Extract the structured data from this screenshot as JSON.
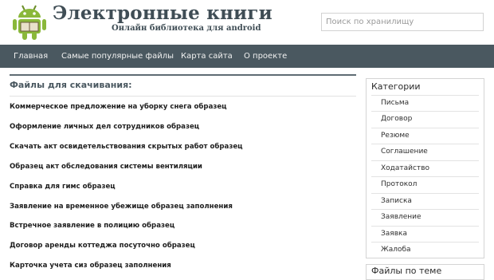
{
  "header": {
    "site_title": "Электронные книги",
    "site_subtitle": "Онлайн библиотека для android",
    "search_placeholder": "Поиск по хранилищу"
  },
  "nav": {
    "items": [
      {
        "label": "Главная"
      },
      {
        "label": "Самые популярные файлы"
      },
      {
        "label": "Карта сайта"
      },
      {
        "label": "О проекте"
      }
    ]
  },
  "main": {
    "title": "Файлы для скачивания:",
    "files": [
      "Коммерческое предложение на уборку снега образец",
      "Оформление личных дел сотрудников образец",
      "Скачать акт освидетельствования скрытых работ образец",
      "Образец акт обследования системы вентиляции",
      "Справка для гимс образец",
      "Заявление на временное убежище образец заполнения",
      "Встречное заявление в полицию образец",
      "Договор аренды коттеджа посуточно образец",
      "Карточка учета сиз образец заполнения"
    ]
  },
  "sidebar": {
    "title": "Категории",
    "categories": [
      "Письма",
      "Договор",
      "Резюме",
      "Соглашение",
      "Ходатайство",
      "Протокол",
      "Записка",
      "Заявление",
      "Заявка",
      "Жалоба"
    ]
  },
  "sidebar2": {
    "title": "Файлы по теме"
  },
  "colors": {
    "nav_bg": "#4a5860",
    "title_color": "#3f4d55",
    "logo_green": "#8ab83a"
  },
  "icons": {
    "logo": "android-robot-icon"
  }
}
